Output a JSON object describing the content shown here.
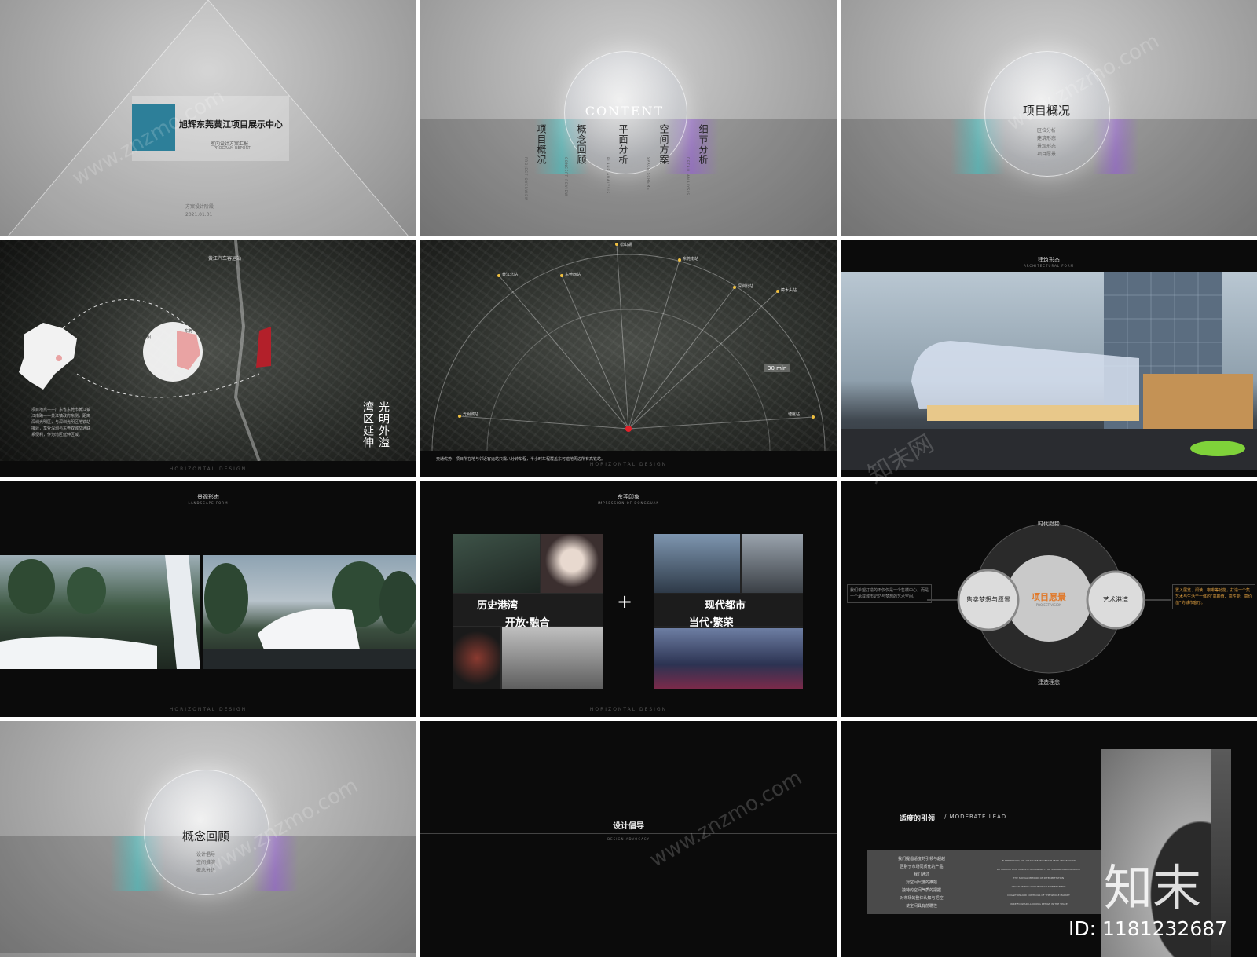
{
  "slide1": {
    "title": "旭辉东莞黄江项目展示中心",
    "subtitle": "室内设计方案汇报",
    "subtitle_en": "PROGRAM REPORT",
    "date_label": "方案设计阶段",
    "date": "2021.01.01"
  },
  "slide2": {
    "orb_text": "CONTENT",
    "items": [
      {
        "cn": "项目概况",
        "en": "PROJECT OVERVIEW"
      },
      {
        "cn": "概念回顾",
        "en": "CONCEPT REVIEW"
      },
      {
        "cn": "平面分析",
        "en": "PLANE ANALYSIS"
      },
      {
        "cn": "空间方案",
        "en": "SPACE SCHEME"
      },
      {
        "cn": "细节分析",
        "en": "DETAIL ANALYSIS"
      }
    ]
  },
  "slide3": {
    "orb_title": "项目概况",
    "orb_items": [
      "区位分析",
      "建筑形态",
      "景观形态",
      "项目愿景"
    ]
  },
  "slide4": {
    "map_label": "黄江汽车客运站",
    "city_a": "广州",
    "city_b": "东莞",
    "slogan_right": "光明外溢",
    "slogan_left": "湾区延伸",
    "body": "项目地点——广东省东莞市黄江镇江南路——黄江镇政府东侧，距离深圳光明区，与深圳光明区地铁站接驳，享受深圳与东莞双城交通联系便利，作为湾区延伸区域。",
    "footer": "HORIZONTAL DESIGN"
  },
  "slide5": {
    "labels": [
      "黄江北站",
      "东莞西站",
      "松山湖",
      "东莞南站",
      "深圳北站",
      "樟木头站",
      "光明城站",
      "塘厦站"
    ],
    "badge": "30 min",
    "caption": "交通优势：项目所在地与邻近客运站只需八分钟车程，半小时车程覆盖东可遍地周边所有高铁站。",
    "footer": "HORIZONTAL DESIGN"
  },
  "slide6": {
    "title": "建筑形态",
    "title_en": "ARCHITECTURAL FORM"
  },
  "slide7": {
    "title": "景观形态",
    "title_en": "LANDSCAPE FORM",
    "footer": "HORIZONTAL DESIGN"
  },
  "slide8": {
    "title": "东莞印象",
    "title_en": "IMPRESSION OF DONGGUAN",
    "left_line1": "历史港湾",
    "left_line2": "开放·融合",
    "plus": "+",
    "right_line1": "现代都市",
    "right_line2": "当代·繁荣",
    "footer": "HORIZONTAL DESIGN"
  },
  "slide9": {
    "top": "时代趋势",
    "bottom": "建造理念",
    "center": "项目愿景",
    "center_en": "PROJECT VISION",
    "left_node": "售卖梦想与愿景",
    "right_node": "艺术港湾",
    "left_text": "我们希望打造的不仅仅是一个售楼中心，而是一个承载城市记忆与梦想的艺术空间。",
    "right_text": "置入展览、阅读、咖啡等功能，打造一个集艺术与生活于一体的“高颜值、高性能、高价值”的城市客厅。"
  },
  "slide10": {
    "orb_title": "概念回顾",
    "orb_items": [
      "设计倡导",
      "空间推演",
      "概念分析"
    ]
  },
  "slide11": {
    "title": "设计倡导",
    "title_en": "DESIGN ADVOCACY"
  },
  "slide12": {
    "heading": "适度的引领",
    "heading_en": "/ MODERATE LEAD",
    "cn_lines": [
      "我们提倡适度的引领与超越",
      "区别于市场同质化的产品",
      "我们通过",
      "对空间尺度的推敲",
      "独特的空间气质的把握",
      "对市场的整体认知与把控",
      "使空间具有前瞻性"
    ],
    "en_lines": [
      "IN THE DESIGN, WE ADVOCATE MODERATE LEAD AND BEYOND",
      "DIFFERENT FROM MARKET HOMOGENEITY OF SIMILAR VILLA PRODUCT",
      "THE SPATIAL MEMORY OF INTERPRETATION",
      "GRASP OF THE UNIQUE SPACE TEMPERAMENT",
      "COGNITION AND CONTROLS OF THE WHOLE MARKET",
      "MAKE FORWARD-LOOKING DESIGN IN THE SPACE"
    ]
  },
  "brand": {
    "logo": "知末",
    "id": "ID: 1181232687",
    "watermark": "www.znzmo.com",
    "watermark2": "知末网"
  }
}
